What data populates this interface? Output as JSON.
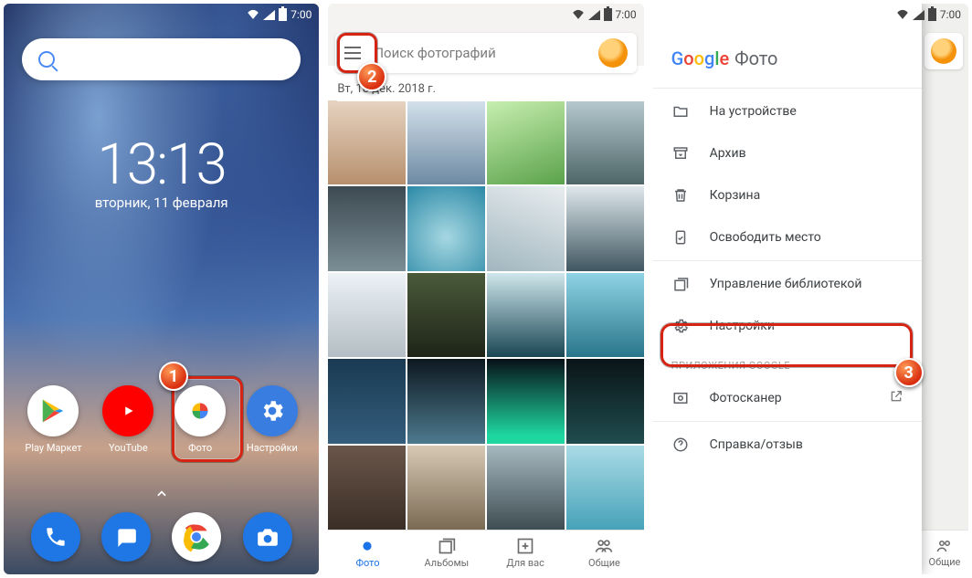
{
  "status_time": "7:00",
  "home": {
    "time": "13:13",
    "date": "вторник, 11 февраля",
    "apps": [
      {
        "label": "Play Маркет"
      },
      {
        "label": "YouTube"
      },
      {
        "label": "Фото"
      },
      {
        "label": "Настройки"
      }
    ]
  },
  "grid": {
    "search_placeholder": "Поиск фотографий",
    "date_header": "Вт, 18 дек. 2018 г.",
    "nav": {
      "photos": "Фото",
      "albums": "Альбомы",
      "foryou": "Для вас",
      "sharing": "Общие"
    }
  },
  "drawer": {
    "brand_suffix": "Фото",
    "items": {
      "on_device": "На устройстве",
      "archive": "Архив",
      "trash": "Корзина",
      "free_up": "Освободить место",
      "library": "Управление библиотекой",
      "settings": "Настройки"
    },
    "section_google_apps": "ПРИЛОЖЕНИЯ GOOGLE",
    "photoscan": "Фотосканер",
    "help": "Справка/отзыв",
    "bottom_stub": "Общие"
  },
  "markers": {
    "m1": "1",
    "m2": "2",
    "m3": "3"
  }
}
